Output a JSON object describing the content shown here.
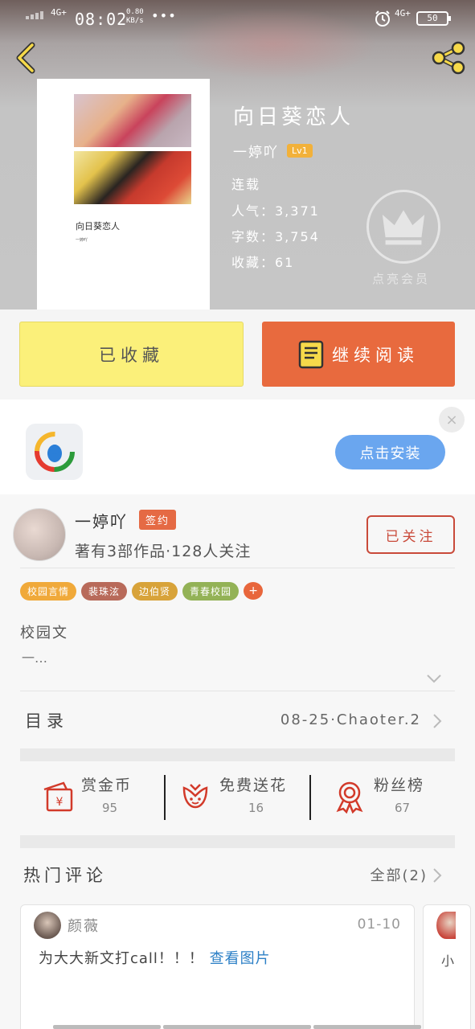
{
  "status_bar": {
    "network_left": "4G+",
    "time": "08:02",
    "speed_value": "0.80",
    "speed_unit": "KB/s",
    "more": "•••",
    "network_right": "4G+",
    "battery": "50"
  },
  "book": {
    "cover_title": "向日葵恋人",
    "cover_author": "一婷吖",
    "title": "向日葵恋人",
    "author": "一婷吖",
    "level": "Lv1",
    "status": "连载",
    "popularity": "人气：3,371",
    "word_count": "字数：3,754",
    "favorites": "收藏：61",
    "vip_label": "点亮会员"
  },
  "actions": {
    "favorited_label": "已收藏",
    "continue_label": "继续阅读"
  },
  "ad": {
    "install_label": "点击安装",
    "close": "×"
  },
  "author_card": {
    "name": "一婷吖",
    "badge": "签约",
    "works": "著有3部作品·128人关注",
    "follow_label": "已关注"
  },
  "tags": [
    {
      "label": "校园言情",
      "color": "#f0a93a"
    },
    {
      "label": "裴珠泫",
      "color": "#b86a5a"
    },
    {
      "label": "边伯贤",
      "color": "#d8a33a"
    },
    {
      "label": "青春校园",
      "color": "#93b256"
    },
    {
      "label": "+",
      "color": "#e8663c"
    }
  ],
  "description": {
    "line1": "校园文",
    "line2": "一…"
  },
  "toc": {
    "label": "目录",
    "latest": "08-25·Chaoter.2"
  },
  "stats": {
    "reward": {
      "label": "赏金币",
      "value": "95",
      "icon": "red-envelope-icon"
    },
    "flower": {
      "label": "免费送花",
      "value": "16",
      "icon": "flower-icon"
    },
    "fans": {
      "label": "粉丝榜",
      "value": "67",
      "icon": "medal-icon"
    }
  },
  "comments_section": {
    "title": "热门评论",
    "all_label": "全部(2)",
    "items": [
      {
        "user": "颜薇",
        "date": "01-10",
        "text": "为大大新文打call！！！",
        "link": "查看图片"
      },
      {
        "user": "",
        "date": "",
        "text": "小",
        "link": ""
      }
    ]
  },
  "colors": {
    "accent_orange": "#e86a3e",
    "favorite_yellow": "#fbf07a",
    "follow_red": "#c94a3a",
    "install_blue": "#6aa6ef"
  }
}
